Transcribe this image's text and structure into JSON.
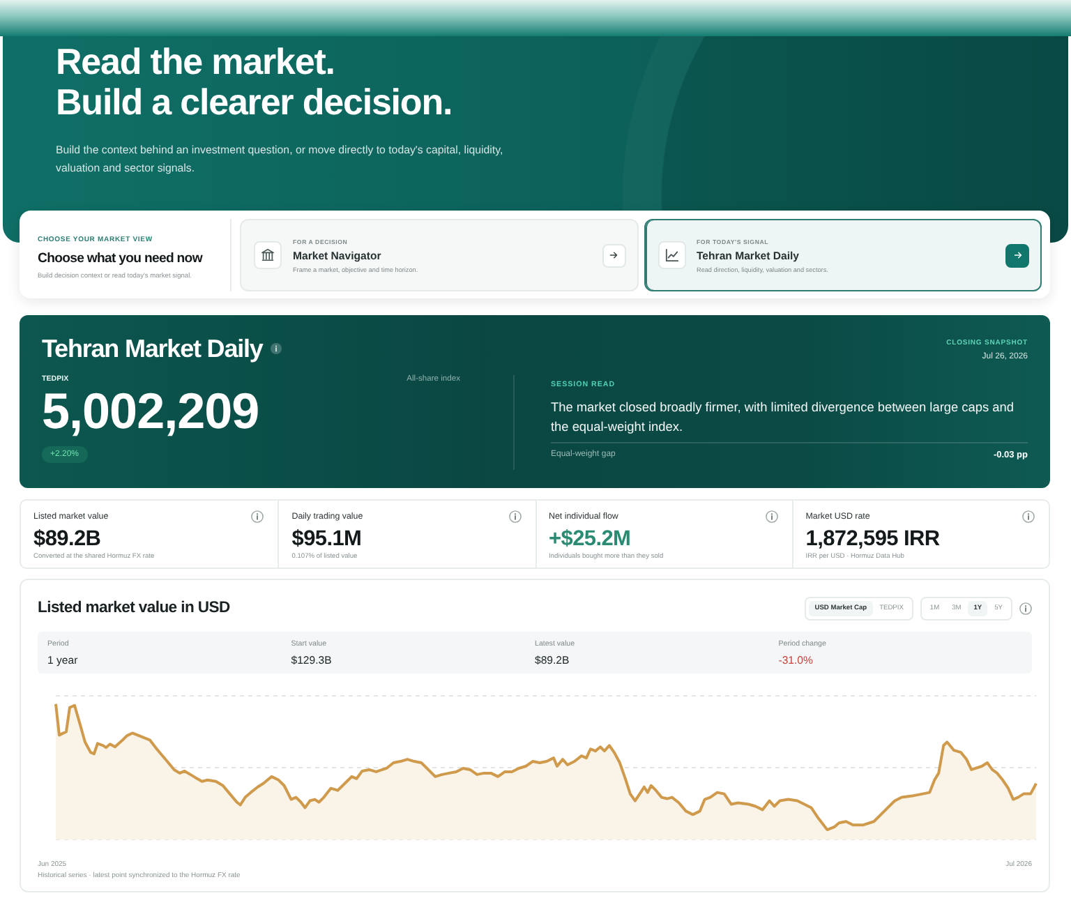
{
  "hero": {
    "headline": [
      "Read the market.",
      "Build a clearer decision."
    ],
    "description": "Build the context behind an investment question, or move directly to today's capital, liquidity, valuation and sector signals."
  },
  "view_chooser": {
    "eyebrow": "CHOOSE YOUR MARKET VIEW",
    "title": "Choose what you need now",
    "subtitle": "Build decision context or read today's market signal.",
    "options": [
      {
        "kind": "navigator",
        "eyebrow": "FOR A DECISION",
        "title": "Market Navigator",
        "description": "Frame a market, objective and time horizon.",
        "selected": false
      },
      {
        "kind": "daily",
        "eyebrow": "FOR TODAY'S SIGNAL",
        "title": "Tehran Market Daily",
        "description": "Read direction, liquidity, valuation and sectors.",
        "selected": true
      }
    ]
  },
  "daily_panel": {
    "title": "Tehran Market Daily",
    "snapshot_label": "CLOSING SNAPSHOT",
    "snapshot_date": "Jul 26, 2026",
    "index_label": "TEDPIX",
    "index_note": "All-share index",
    "index_value": "5,002,209",
    "change": "+2.20%",
    "change_positive": true,
    "session_label": "SESSION READ",
    "session_text": "The market closed broadly firmer, with limited divergence between large caps and the equal-weight index.",
    "gap_label": "Equal-weight gap",
    "gap_value": "-0.03 pp"
  },
  "metrics": [
    {
      "label": "Listed market value",
      "value": "$89.2B",
      "caption": "Converted at the shared Hormuz FX rate",
      "positive": false
    },
    {
      "label": "Daily trading value",
      "value": "$95.1M",
      "caption": "0.107% of listed value",
      "positive": false
    },
    {
      "label": "Net individual flow",
      "value": "+$25.2M",
      "caption": "Individuals bought more than they sold",
      "positive": true
    },
    {
      "label": "Market USD rate",
      "value": "1,872,595 IRR",
      "caption": "IRR per USD · Hormuz Data Hub",
      "positive": false
    }
  ],
  "chart_card": {
    "title": "Listed market value in USD",
    "series_tabs": [
      {
        "label": "USD Market Cap",
        "selected": true
      },
      {
        "label": "TEDPIX",
        "selected": false
      }
    ],
    "range_tabs": [
      {
        "label": "1M",
        "selected": false
      },
      {
        "label": "3M",
        "selected": false
      },
      {
        "label": "1Y",
        "selected": true
      },
      {
        "label": "5Y",
        "selected": false
      }
    ],
    "stats": [
      {
        "label": "Period",
        "value": "1 year",
        "negative": false
      },
      {
        "label": "Start value",
        "value": "$129.3B",
        "negative": false
      },
      {
        "label": "Latest value",
        "value": "$89.2B",
        "negative": false
      },
      {
        "label": "Period change",
        "value": "-31.0%",
        "negative": true
      }
    ],
    "x_start": "Jun 2025",
    "x_end": "Jul 2026",
    "footnote": "Historical series · latest point synchronized to the Hormuz FX rate"
  }
}
